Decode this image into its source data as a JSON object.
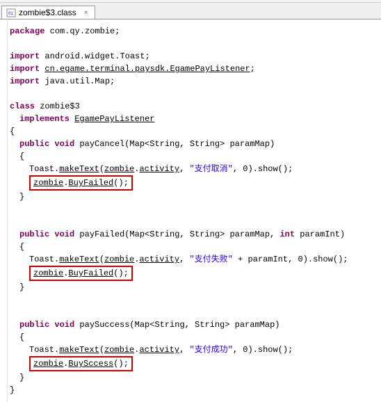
{
  "tab": {
    "filename": "zombie$3.class",
    "close": "×"
  },
  "code": {
    "package_kw": "package",
    "package_name": "com.qy.zombie;",
    "import_kw": "import",
    "import1": "android.widget.Toast;",
    "import2": "cn.egame.terminal.paysdk.EgamePayListener",
    "import2_semi": ";",
    "import3": "java.util.Map;",
    "class_kw": "class",
    "class_name": "zombie$3",
    "implements_kw": "implements",
    "interface_name": "EgamePayListener",
    "open_brace": "{",
    "close_brace": "}",
    "public_void": "public void",
    "method1_sig": "payCancel(Map<String, String> paramMap)",
    "toast_prefix": "Toast.",
    "makeText": "makeText",
    "zombie_word": "zombie",
    "dot": ".",
    "activity_word": "activity",
    "comma_sp": ", ",
    "str_cancel": "\"支付取消\"",
    "zero_show": ", 0).show();",
    "buyfailed_call": ".BuyFailed();",
    "buyfailed_underline": "BuyFailed",
    "paren_tail": "();",
    "open_paren": "(",
    "method2_sig": "payFailed(Map<String, String> paramMap, ",
    "method2_int_kw": "int",
    "method2_tail": " paramInt)",
    "str_fail": "\"支付失败\"",
    "plus_param": " + paramInt, 0).show();",
    "method3_sig": "paySuccess(Map<String, String> paramMap)",
    "str_success": "\"支付成功\"",
    "buysuccess_underline": "BuySccess"
  }
}
